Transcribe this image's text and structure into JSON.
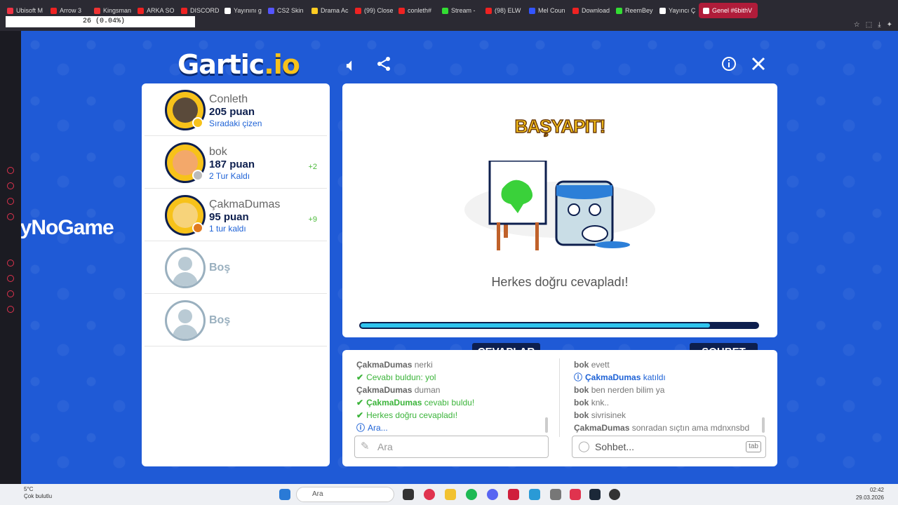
{
  "browser": {
    "tabs": [
      {
        "label": "Ubisoft M",
        "color": "#e34"
      },
      {
        "label": "Arrow 3",
        "color": "#e22"
      },
      {
        "label": "Kingsman",
        "color": "#e33"
      },
      {
        "label": "ARKA SO",
        "color": "#e22"
      },
      {
        "label": "DISCORD",
        "color": "#e22"
      },
      {
        "label": "Yayınını g",
        "color": "#fff"
      },
      {
        "label": "CS2 Skin",
        "color": "#55f"
      },
      {
        "label": "Drama Ac",
        "color": "#fc2"
      },
      {
        "label": "(99) Close",
        "color": "#e22"
      },
      {
        "label": "conleth#",
        "color": "#e22"
      },
      {
        "label": "Stream -",
        "color": "#3d3"
      },
      {
        "label": "(98) ELW",
        "color": "#e22"
      },
      {
        "label": "Mel Coun",
        "color": "#35f"
      },
      {
        "label": "Download",
        "color": "#e22"
      },
      {
        "label": "ReemBey",
        "color": "#3d3"
      },
      {
        "label": "Yayıncı Ç",
        "color": "#fff"
      },
      {
        "label": "Genel #6bithV",
        "color": "#fff"
      }
    ],
    "counter_text": "26 (0.04%)"
  },
  "game": {
    "logo_main": "Gartic",
    "logo_suffix": ".io",
    "watermark": "ByNoGame",
    "players": [
      {
        "name": "Conleth",
        "points": "205 puan",
        "status": "Sıradaki çizen",
        "bonus": "",
        "dot": "#f7c21a",
        "avatar": "#5a4a3a"
      },
      {
        "name": "bok",
        "points": "187 puan",
        "status": "2 Tur Kaldı",
        "bonus": "+2",
        "dot": "#bbbbbb",
        "avatar": "#f3a86a"
      },
      {
        "name": "ÇakmaDumas",
        "points": "95 puan",
        "status": "1 tur kaldı",
        "bonus": "+9",
        "dot": "#e07a1f",
        "avatar": "#f7d37a"
      }
    ],
    "empty_slots": [
      "Boş",
      "Boş"
    ],
    "canvas": {
      "title": "BAŞYAPIT!",
      "message": "Herkes doğru cevapladı!",
      "progress": 0.88
    },
    "answers": {
      "badge": "CEVAPLAR",
      "messages": [
        {
          "user": "ÇakmaDumas",
          "text": "nerki",
          "type": "normal"
        },
        {
          "user": "",
          "text": "Cevabı buldun: yol",
          "type": "ok"
        },
        {
          "user": "ÇakmaDumas",
          "text": "duman",
          "type": "normal"
        },
        {
          "user": "ÇakmaDumas",
          "text": "cevabı buldu!",
          "type": "ok"
        },
        {
          "user": "",
          "text": "Herkes doğru cevapladı!",
          "type": "ok"
        },
        {
          "user": "",
          "text": "Ara...",
          "type": "info"
        }
      ],
      "placeholder": "Ara"
    },
    "chat": {
      "badge": "SOHBET",
      "messages": [
        {
          "user": "bok",
          "text": "evett",
          "type": "normal"
        },
        {
          "user": "ÇakmaDumas",
          "text": "katıldı",
          "type": "info"
        },
        {
          "user": "bok",
          "text": "ben nerden bilim ya",
          "type": "normal"
        },
        {
          "user": "bok",
          "text": "knk..",
          "type": "normal"
        },
        {
          "user": "bok",
          "text": "sivrisinek",
          "type": "normal"
        },
        {
          "user": "ÇakmaDumas",
          "text": "sonradan sıçtın ama mdnxnsbd",
          "type": "normal"
        }
      ],
      "placeholder": "Sohbet...",
      "tab_hint": "tab"
    }
  },
  "taskbar": {
    "temp": "5°C",
    "weather": "Çok bulutlu",
    "search": "Ara",
    "time": "02:42",
    "date": "29.03.2026"
  }
}
